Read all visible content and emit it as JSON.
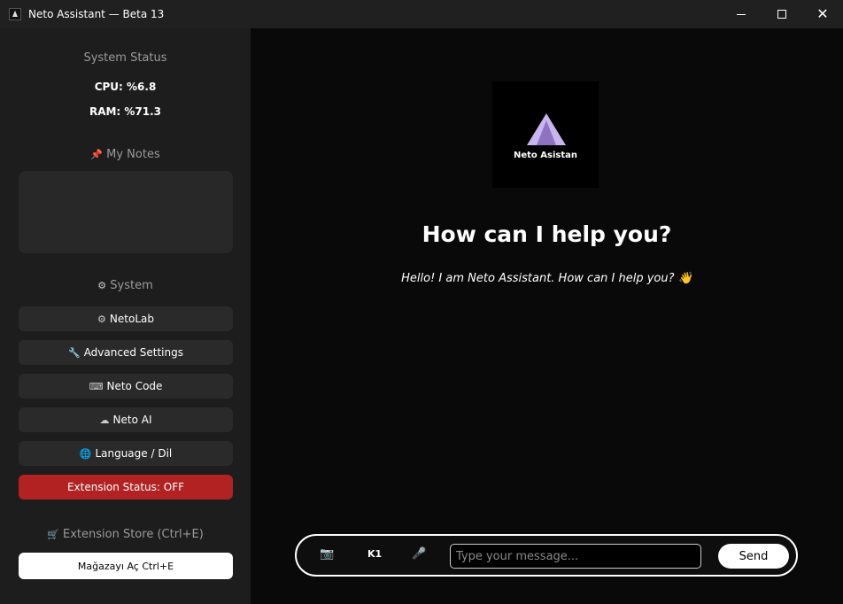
{
  "window": {
    "title": "Neto Assistant — Beta 13"
  },
  "sidebar": {
    "system_status_title": "System Status",
    "cpu": "CPU: %6.8",
    "ram": "RAM: %71.3",
    "notes_title": "My Notes",
    "system_title": "System",
    "buttons": [
      {
        "label": "NetoLab",
        "icon": "gear-icon"
      },
      {
        "label": "Advanced Settings",
        "icon": "wrench-icon"
      },
      {
        "label": "Neto Code",
        "icon": "code-icon"
      },
      {
        "label": "Neto AI",
        "icon": "brain-icon"
      },
      {
        "label": "Language / Dil",
        "icon": "globe-icon"
      }
    ],
    "extension_status": "Extension Status: OFF",
    "extension_status_color": "#b22222",
    "store_title": "Extension Store",
    "store_shortcut": "(Ctrl+E)",
    "store_button": "Mağazayı Aç  Ctrl+E"
  },
  "main": {
    "logo_text": "Neto Asistan",
    "headline": "How can I help you?",
    "greeting": "Hello! I am Neto Assistant. How can I help you?"
  },
  "input_bar": {
    "keyboard_label": "K1",
    "placeholder": "Type your message...",
    "send_label": "Send"
  }
}
